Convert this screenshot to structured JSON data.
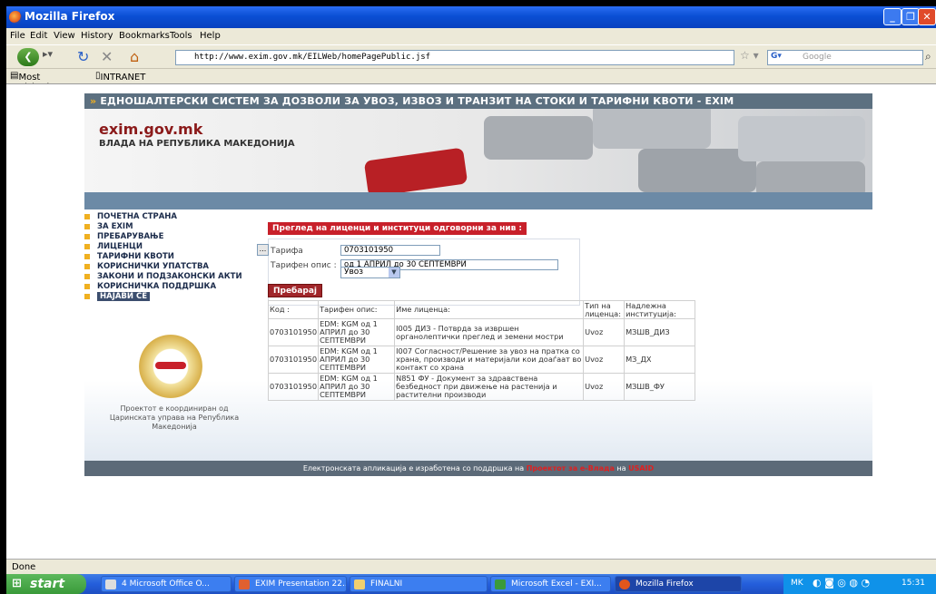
{
  "browser": {
    "title": "Mozilla Firefox",
    "menu": [
      "File",
      "Edit",
      "View",
      "History",
      "Bookmarks",
      "Tools",
      "Help"
    ],
    "url": "http://www.exim.gov.mk/EILWeb/homePagePublic.jsf",
    "search_placeholder": "Google",
    "bookmarks": [
      "Most Visited",
      "INTRANET CURM"
    ],
    "status": "Done"
  },
  "site": {
    "topbar": "ЕДНОШАЛТЕРСКИ СИСТЕМ ЗА ДОЗВОЛИ ЗА УВОЗ, ИЗВОЗ И ТРАНЗИТ НА СТОКИ И ТАРИФНИ КВОТИ - EXIM",
    "domain": "exim.gov.mk",
    "government": "ВЛАДА НА РЕПУБЛИКА МАКЕДОНИЈА",
    "nav": [
      {
        "label": "ПОЧЕТНА СТРАНА"
      },
      {
        "label": "ЗА EXIM"
      },
      {
        "label": "ПРЕБАРУВАЊЕ"
      },
      {
        "label": "ЛИЦЕНЦИ"
      },
      {
        "label": "ТАРИФНИ КВОТИ"
      },
      {
        "label": "КОРИСНИЧКИ УПАТСТВА"
      },
      {
        "label": "ЗАКОНИ И ПОДЗАКОНСКИ АКТИ"
      },
      {
        "label": "КОРИСНИЧКА ПОДДРШКА"
      },
      {
        "label": "НАЈАВИ СЕ"
      }
    ],
    "coordination": "Проектот е координиран од Царинската управа на Република Македонија",
    "section_title": "Преглед на лиценци и институци одговорни за нив :",
    "form": {
      "tariff_label": "Тарифа",
      "tariff_value": "0703101950",
      "browse": "...",
      "desc_label": "Тарифен опис :",
      "desc_value": "од 1 АПРИЛ до 30 СЕПТЕМВРИ",
      "direction": "Увоз",
      "search_button": "Пребарај"
    },
    "table": {
      "headers": [
        "Код :",
        "Тарифен опис:",
        "Име лиценца:",
        "Тип на лиценца:",
        "Надлежна институција:"
      ],
      "rows": [
        [
          "0703101950",
          "EDM: KGM од 1 АПРИЛ до 30 СЕПТЕМВРИ",
          "I005 ДИЗ - Потврда за извршен органолептички преглед и земени мостри",
          "Uvoz",
          "МЗШВ_ДИЗ"
        ],
        [
          "0703101950",
          "EDM: KGM од 1 АПРИЛ до 30 СЕПТЕМВРИ",
          "I007 Согласност/Решение за увоз на пратка со храна, производи и материјали кои доаѓаат во контакт со храна",
          "Uvoz",
          "МЗ_ДХ"
        ],
        [
          "0703101950",
          "EDM: KGM од 1 АПРИЛ до 30 СЕПТЕМВРИ",
          "N851 ФУ - Документ за здравствена безбедност при движење на растенија и растителни производи",
          "Uvoz",
          "МЗШВ_ФУ"
        ]
      ]
    },
    "footer": {
      "text1": "Електронската апликација е изработена со поддршка на",
      "link1": "Проектот за е-Влада",
      "text2": "на",
      "link2": "USAID"
    }
  },
  "taskbar": {
    "start": "start",
    "items": [
      "4 Microsoft Office O...",
      "EXIM Presentation 22...",
      "FINALNI",
      "Microsoft Excel - EXI...",
      "Mozilla Firefox"
    ],
    "lang": "MK",
    "clock": "15:31"
  }
}
